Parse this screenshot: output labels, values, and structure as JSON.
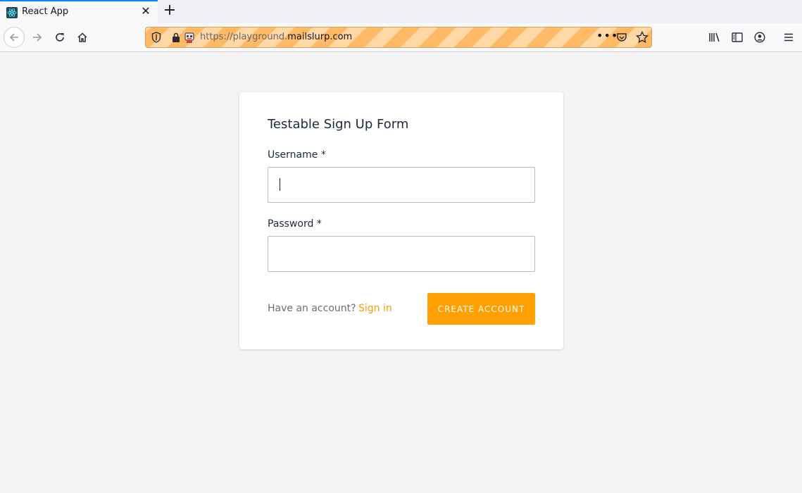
{
  "browser": {
    "tab_title": "React App",
    "tab_close": "✕",
    "new_tab": "+",
    "url_prefix": "https://playground.",
    "url_domain": "mailslurp.com",
    "url_more": "•••"
  },
  "form": {
    "title": "Testable Sign Up Form",
    "username_label": "Username *",
    "username_value": "",
    "password_label": "Password *",
    "password_value": "",
    "have_account": "Have an account?",
    "sign_in": "Sign in",
    "create_button": "CREATE ACCOUNT"
  },
  "colors": {
    "accent": "#ff9f00",
    "link": "#f6a000",
    "urlbar_stripe_a": "#fdb966",
    "urlbar_stripe_b": "#ffd8a6"
  }
}
